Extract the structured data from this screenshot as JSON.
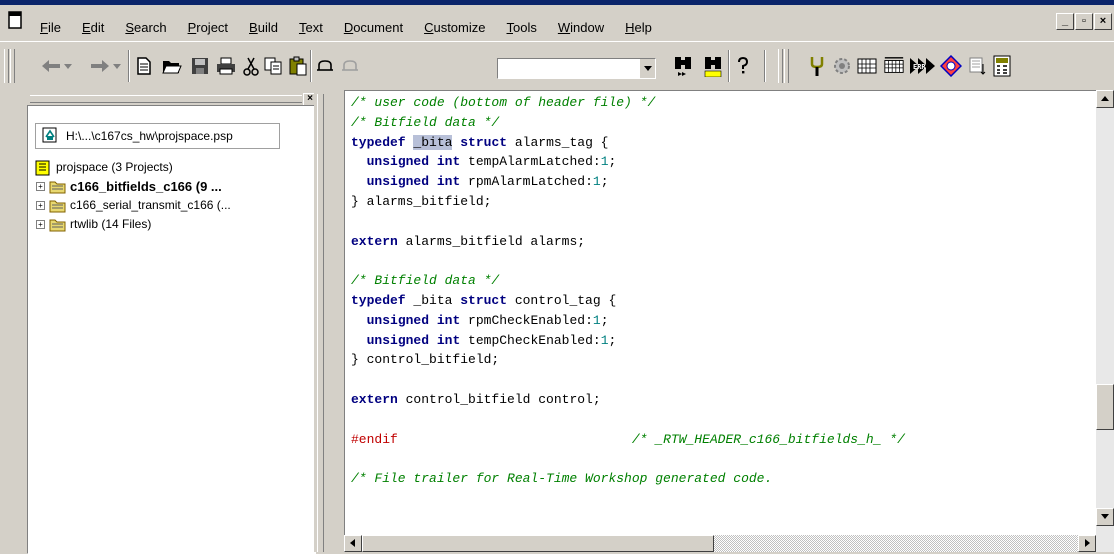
{
  "menu": {
    "items": [
      {
        "ul": "F",
        "rest": "ile"
      },
      {
        "ul": "E",
        "rest": "dit"
      },
      {
        "ul": "S",
        "rest": "earch"
      },
      {
        "ul": "P",
        "rest": "roject"
      },
      {
        "ul": "B",
        "rest": "uild"
      },
      {
        "ul": "T",
        "rest": "ext"
      },
      {
        "ul": "D",
        "rest": "ocument"
      },
      {
        "ul": "C",
        "rest": "ustomize"
      },
      {
        "ul": "T",
        "rest": "ools"
      },
      {
        "ul": "W",
        "rest": "indow"
      },
      {
        "ul": "H",
        "rest": "elp"
      }
    ]
  },
  "window_controls": {
    "minimize": "_",
    "restore": "▫",
    "close": "×"
  },
  "toolbar": {
    "search_value": ""
  },
  "project": {
    "path": "H:\\...\\c167cs_hw\\projspace.psp",
    "tree": [
      {
        "label": "projspace (3 Projects)",
        "bold": false,
        "expander": "",
        "level": 0
      },
      {
        "label": "c166_bitfields_c166 (9 ...",
        "bold": true,
        "expander": "+",
        "level": 1
      },
      {
        "label": "c166_serial_transmit_c166 (...",
        "bold": false,
        "expander": "+",
        "level": 1
      },
      {
        "label": "rtwlib (14 Files)",
        "bold": false,
        "expander": "+",
        "level": 1
      }
    ]
  },
  "editor": {
    "lines": [
      "/* user code (bottom of header file) */",
      "/* Bitfield data */",
      "typedef _bita struct alarms_tag {",
      "  unsigned int tempAlarmLatched:1;",
      "  unsigned int rpmAlarmLatched:1;",
      "} alarms_bitfield;",
      "",
      "extern alarms_bitfield alarms;",
      "",
      "/* Bitfield data */",
      "typedef _bita struct control_tag {",
      "  unsigned int rpmCheckEnabled:1;",
      "  unsigned int tempCheckEnabled:1;",
      "} control_bitfield;",
      "",
      "extern control_bitfield control;",
      "",
      "#endif                              /* _RTW_HEADER_c166_bitfields_h_ */",
      "",
      "/* File trailer for Real-Time Workshop generated code."
    ],
    "highlight_token": "_bita"
  },
  "colors": {
    "comment": "#008000",
    "keyword": "#000080",
    "preprocessor": "#c00000",
    "number": "#008080"
  }
}
